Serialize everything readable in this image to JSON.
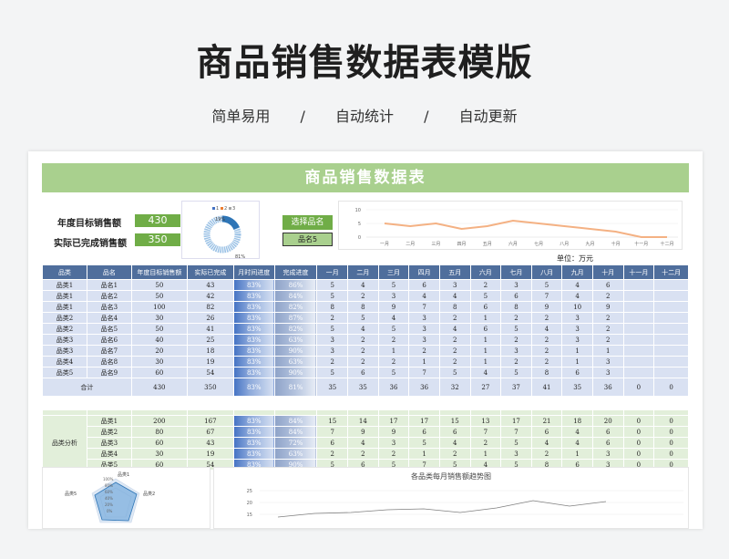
{
  "header": {
    "title": "商品销售数据表模版",
    "subtitle": [
      "简单易用",
      "/",
      "自动统计",
      "/",
      "自动更新"
    ]
  },
  "sheet": {
    "banner": "商品销售数据表",
    "kpi": {
      "target_label": "年度目标销售额",
      "target_value": "430",
      "actual_label": "实际已完成销售额",
      "actual_value": "350"
    },
    "select_label": "选择品名",
    "select_value": "品名5",
    "unit": "单位：万元",
    "donut": {
      "legend": [
        "1",
        "2",
        "3"
      ],
      "legend_colors": [
        "#4472c4",
        "#ed7d31",
        "#a5a5a5"
      ],
      "top_label": "19%",
      "bottom_label": "81%"
    },
    "line_chart": {
      "y_ticks": [
        "10",
        "5",
        "0"
      ],
      "months": [
        "一月",
        "二月",
        "三月",
        "四月",
        "五月",
        "六月",
        "七月",
        "八月",
        "九月",
        "十月",
        "十一月",
        "十二月"
      ]
    },
    "main_table": {
      "headers": [
        "品类",
        "品名",
        "年度目标销售额",
        "实际已完成",
        "月时间进度",
        "完成进度",
        "一月",
        "二月",
        "三月",
        "四月",
        "五月",
        "六月",
        "七月",
        "八月",
        "九月",
        "十月",
        "十一月",
        "十二月"
      ],
      "rows": [
        [
          "品类1",
          "品名1",
          "50",
          "43",
          "83%",
          "86%",
          "5",
          "4",
          "5",
          "6",
          "3",
          "2",
          "3",
          "5",
          "4",
          "6",
          "",
          ""
        ],
        [
          "品类1",
          "品名2",
          "50",
          "42",
          "83%",
          "84%",
          "5",
          "2",
          "3",
          "4",
          "4",
          "5",
          "6",
          "7",
          "4",
          "2",
          "",
          ""
        ],
        [
          "品类1",
          "品名3",
          "100",
          "82",
          "83%",
          "82%",
          "8",
          "8",
          "9",
          "7",
          "8",
          "6",
          "8",
          "9",
          "10",
          "9",
          "",
          ""
        ],
        [
          "品类2",
          "品名4",
          "30",
          "26",
          "83%",
          "87%",
          "2",
          "5",
          "4",
          "3",
          "2",
          "1",
          "2",
          "2",
          "3",
          "2",
          "",
          ""
        ],
        [
          "品类2",
          "品名5",
          "50",
          "41",
          "83%",
          "82%",
          "5",
          "4",
          "5",
          "3",
          "4",
          "6",
          "5",
          "4",
          "3",
          "2",
          "",
          ""
        ],
        [
          "品类3",
          "品名6",
          "40",
          "25",
          "83%",
          "63%",
          "3",
          "2",
          "2",
          "3",
          "2",
          "1",
          "2",
          "2",
          "3",
          "2",
          "",
          ""
        ],
        [
          "品类3",
          "品名7",
          "20",
          "18",
          "83%",
          "90%",
          "3",
          "2",
          "1",
          "2",
          "2",
          "1",
          "3",
          "2",
          "1",
          "1",
          "",
          ""
        ],
        [
          "品类4",
          "品名8",
          "30",
          "19",
          "83%",
          "63%",
          "2",
          "2",
          "2",
          "1",
          "2",
          "1",
          "2",
          "2",
          "1",
          "3",
          "",
          ""
        ],
        [
          "品类5",
          "品名9",
          "60",
          "54",
          "83%",
          "90%",
          "5",
          "6",
          "5",
          "7",
          "5",
          "4",
          "5",
          "8",
          "6",
          "3",
          "",
          ""
        ]
      ],
      "total": [
        "合计",
        "430",
        "350",
        "83%",
        "81%",
        "35",
        "35",
        "36",
        "36",
        "32",
        "27",
        "37",
        "41",
        "35",
        "36",
        "0",
        "0"
      ]
    },
    "category_table": {
      "group_label": "品类分析",
      "rows": [
        [
          "品类1",
          "200",
          "167",
          "83%",
          "84%",
          "15",
          "14",
          "17",
          "17",
          "15",
          "13",
          "17",
          "21",
          "18",
          "20",
          "0",
          "0"
        ],
        [
          "品类2",
          "80",
          "67",
          "83%",
          "84%",
          "7",
          "9",
          "9",
          "6",
          "6",
          "7",
          "7",
          "6",
          "4",
          "6",
          "0",
          "0"
        ],
        [
          "品类3",
          "60",
          "43",
          "83%",
          "72%",
          "6",
          "4",
          "3",
          "5",
          "4",
          "2",
          "5",
          "4",
          "4",
          "6",
          "0",
          "0"
        ],
        [
          "品类4",
          "30",
          "19",
          "83%",
          "63%",
          "2",
          "2",
          "2",
          "1",
          "2",
          "1",
          "3",
          "2",
          "1",
          "3",
          "0",
          "0"
        ],
        [
          "品类5",
          "60",
          "54",
          "83%",
          "90%",
          "5",
          "6",
          "5",
          "7",
          "5",
          "4",
          "5",
          "8",
          "6",
          "3",
          "0",
          "0"
        ]
      ]
    },
    "radar": {
      "labels": [
        "品类1",
        "品类2",
        "品类5"
      ],
      "ticks": [
        "100%",
        "80%",
        "60%",
        "40%",
        "20%",
        "0%"
      ]
    },
    "trend": {
      "title": "各品类每月销售额趋势图",
      "y_ticks": [
        "25",
        "20",
        "15"
      ]
    }
  },
  "colors": {
    "accent_green": "#70ad47",
    "banner_green": "#a9d08e",
    "header_blue": "#4f6e9c",
    "row_blue": "#d9e1f2",
    "row_green": "#e2efda",
    "line_orange": "#f4b183"
  },
  "chart_data": {
    "type": "line",
    "categories": [
      "一月",
      "二月",
      "三月",
      "四月",
      "五月",
      "六月",
      "七月",
      "八月",
      "九月",
      "十月",
      "十一月",
      "十二月"
    ],
    "values": [
      5,
      4,
      5,
      3,
      4,
      6,
      5,
      4,
      3,
      2,
      0,
      0
    ],
    "ylim": [
      0,
      10
    ],
    "grid": true
  }
}
